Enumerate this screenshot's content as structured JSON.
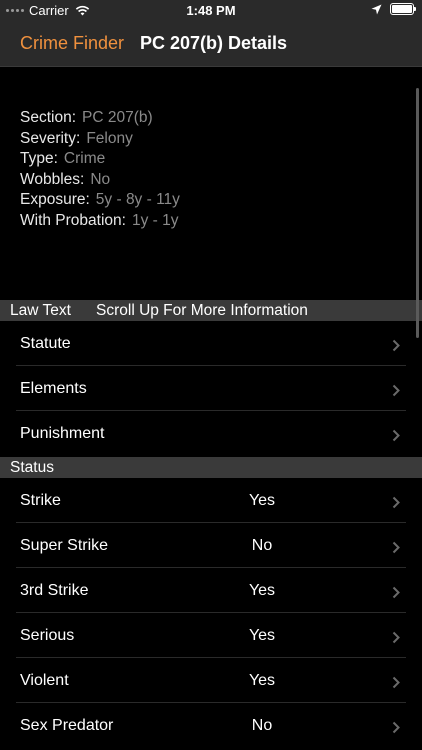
{
  "status_bar": {
    "carrier": "Carrier",
    "time": "1:48 PM"
  },
  "nav": {
    "back_label": "Crime Finder",
    "title": "PC 207(b) Details"
  },
  "details": [
    {
      "key": "Section:",
      "value": "PC 207(b)"
    },
    {
      "key": "Severity:",
      "value": "Felony"
    },
    {
      "key": "Type:",
      "value": "Crime"
    },
    {
      "key": "Wobbles:",
      "value": "No"
    },
    {
      "key": "Exposure:",
      "value": "5y - 8y - 11y"
    },
    {
      "key": "With Probation:",
      "value": "1y - 1y"
    }
  ],
  "law_text": {
    "header": "Law Text",
    "note": "Scroll Up For More Information",
    "items": [
      "Statute",
      "Elements",
      "Punishment"
    ]
  },
  "status": {
    "header": "Status",
    "rows": [
      {
        "label": "Strike",
        "value": "Yes"
      },
      {
        "label": "Super Strike",
        "value": "No"
      },
      {
        "label": "3rd Strike",
        "value": "Yes"
      },
      {
        "label": "Serious",
        "value": "Yes"
      },
      {
        "label": "Violent",
        "value": "Yes"
      },
      {
        "label": "Sex Predator",
        "value": "No"
      }
    ]
  },
  "colors": {
    "accent": "#f0913e",
    "muted": "#8a8a8a",
    "header_bg": "#3a3a3a"
  }
}
